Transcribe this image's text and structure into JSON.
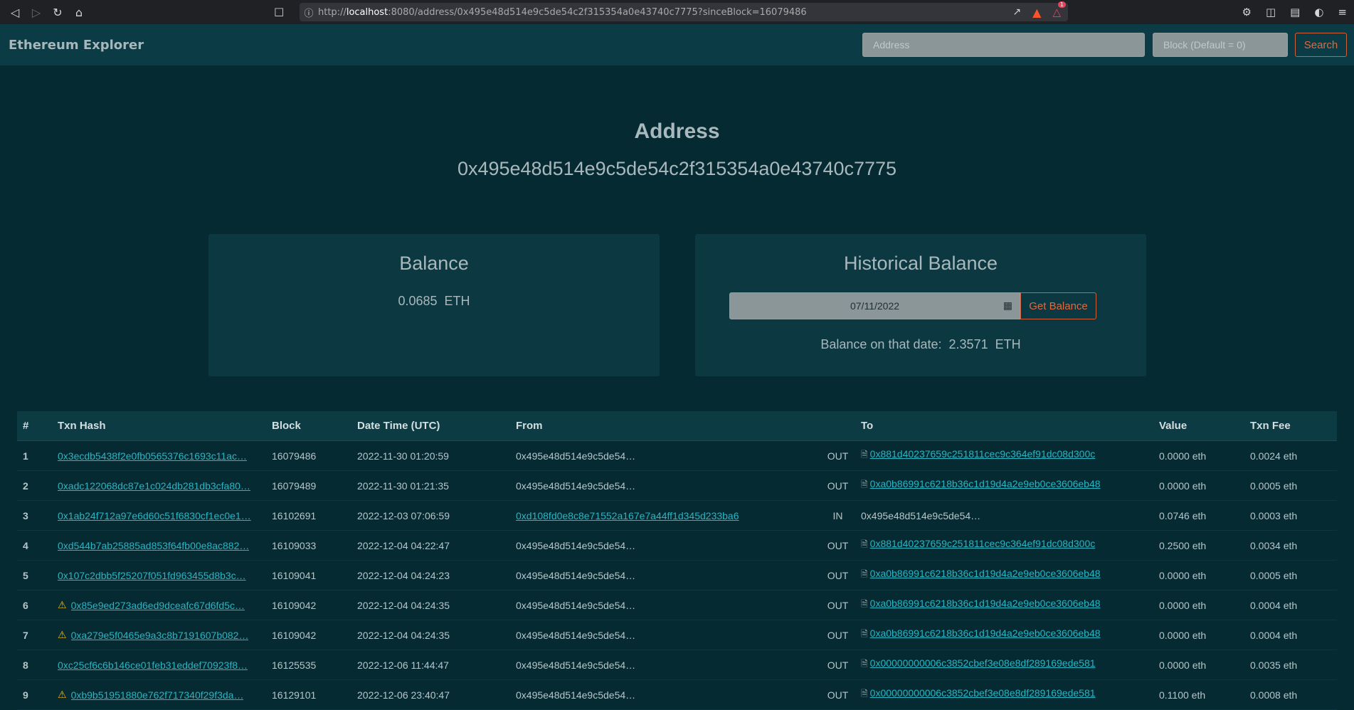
{
  "browser": {
    "url_prefix": "http://",
    "url_host": "localhost",
    "url_rest": ":8080/address/0x495e48d514e9c5de54c2f315354a0e43740c7775?sinceBlock=16079486",
    "rewards_badge": "1"
  },
  "navbar": {
    "brand": "Ethereum Explorer",
    "address_placeholder": "Address",
    "block_placeholder": "Block (Default = 0)",
    "search_label": "Search"
  },
  "header": {
    "title": "Address",
    "address": "0x495e48d514e9c5de54c2f315354a0e43740c7775"
  },
  "balance": {
    "title": "Balance",
    "value": "0.0685",
    "unit": "ETH"
  },
  "historical": {
    "title": "Historical Balance",
    "date": "07/11/2022",
    "button": "Get Balance",
    "result_label": "Balance on that date:",
    "result_value": "2.3571",
    "result_unit": "ETH"
  },
  "table": {
    "headers": [
      "#",
      "Txn Hash",
      "Block",
      "Date Time (UTC)",
      "From",
      "",
      "To",
      "Value",
      "Txn Fee"
    ],
    "rows": [
      {
        "n": "1",
        "hash": "0x3ecdb5438f2e0fb0565376c1693c11ac…",
        "warn": false,
        "block": "16079486",
        "date": "2022-11-30 01:20:59",
        "from": "0x495e48d514e9c5de54…",
        "from_link": false,
        "dir": "OUT",
        "to": "0x881d40237659c251811cec9c364ef91dc08d300c",
        "to_link": true,
        "value": "0.0000 eth",
        "fee": "0.0024 eth"
      },
      {
        "n": "2",
        "hash": "0xadc122068dc87e1c024db281db3cfa80…",
        "warn": false,
        "block": "16079489",
        "date": "2022-11-30 01:21:35",
        "from": "0x495e48d514e9c5de54…",
        "from_link": false,
        "dir": "OUT",
        "to": "0xa0b86991c6218b36c1d19d4a2e9eb0ce3606eb48",
        "to_link": true,
        "value": "0.0000 eth",
        "fee": "0.0005 eth"
      },
      {
        "n": "3",
        "hash": "0x1ab24f712a97e6d60c51f6830cf1ec0e1…",
        "warn": false,
        "block": "16102691",
        "date": "2022-12-03 07:06:59",
        "from": "0xd108fd0e8c8e71552a167e7a44ff1d345d233ba6",
        "from_link": true,
        "dir": "IN",
        "to": "0x495e48d514e9c5de54…",
        "to_link": false,
        "value": "0.0746 eth",
        "fee": "0.0003 eth"
      },
      {
        "n": "4",
        "hash": "0xd544b7ab25885ad853f64fb00e8ac882…",
        "warn": false,
        "block": "16109033",
        "date": "2022-12-04 04:22:47",
        "from": "0x495e48d514e9c5de54…",
        "from_link": false,
        "dir": "OUT",
        "to": "0x881d40237659c251811cec9c364ef91dc08d300c",
        "to_link": true,
        "value": "0.2500 eth",
        "fee": "0.0034 eth"
      },
      {
        "n": "5",
        "hash": "0x107c2dbb5f25207f051fd963455d8b3c…",
        "warn": false,
        "block": "16109041",
        "date": "2022-12-04 04:24:23",
        "from": "0x495e48d514e9c5de54…",
        "from_link": false,
        "dir": "OUT",
        "to": "0xa0b86991c6218b36c1d19d4a2e9eb0ce3606eb48",
        "to_link": true,
        "value": "0.0000 eth",
        "fee": "0.0005 eth"
      },
      {
        "n": "6",
        "hash": "0x85e9ed273ad6ed9dceafc67d6fd5c…",
        "warn": true,
        "block": "16109042",
        "date": "2022-12-04 04:24:35",
        "from": "0x495e48d514e9c5de54…",
        "from_link": false,
        "dir": "OUT",
        "to": "0xa0b86991c6218b36c1d19d4a2e9eb0ce3606eb48",
        "to_link": true,
        "value": "0.0000 eth",
        "fee": "0.0004 eth"
      },
      {
        "n": "7",
        "hash": "0xa279e5f0465e9a3c8b7191607b082…",
        "warn": true,
        "block": "16109042",
        "date": "2022-12-04 04:24:35",
        "from": "0x495e48d514e9c5de54…",
        "from_link": false,
        "dir": "OUT",
        "to": "0xa0b86991c6218b36c1d19d4a2e9eb0ce3606eb48",
        "to_link": true,
        "value": "0.0000 eth",
        "fee": "0.0004 eth"
      },
      {
        "n": "8",
        "hash": "0xc25cf6c6b146ce01feb31eddef70923f8…",
        "warn": false,
        "block": "16125535",
        "date": "2022-12-06 11:44:47",
        "from": "0x495e48d514e9c5de54…",
        "from_link": false,
        "dir": "OUT",
        "to": "0x00000000006c3852cbef3e08e8df289169ede581",
        "to_link": true,
        "value": "0.0000 eth",
        "fee": "0.0035 eth"
      },
      {
        "n": "9",
        "hash": "0xb9b51951880e762f717340f29f3da…",
        "warn": true,
        "block": "16129101",
        "date": "2022-12-06 23:40:47",
        "from": "0x495e48d514e9c5de54…",
        "from_link": false,
        "dir": "OUT",
        "to": "0x00000000006c3852cbef3e08e8df289169ede581",
        "to_link": true,
        "value": "0.1100 eth",
        "fee": "0.0008 eth"
      }
    ]
  },
  "colors": {
    "background": "#052a32",
    "navbar": "#0b3b44",
    "card": "#0c3841",
    "accent_orange": "#e0693f",
    "link": "#27b6c4",
    "warning": "#f5b301"
  },
  "icons": {
    "back": "arrow-left-icon",
    "forward": "arrow-right-icon",
    "reload": "reload-icon",
    "home": "home-icon",
    "bookmark": "bookmark-icon",
    "site_info": "info-icon",
    "share": "share-icon",
    "brave": "brave-lion-icon",
    "rewards": "rewards-triangle-icon",
    "extensions": "puzzle-icon",
    "sidebar": "sidebar-icon",
    "wallet": "wallet-icon",
    "profile": "profile-icon",
    "menu": "menu-icon",
    "calendar": "calendar-icon",
    "contract": "document-icon",
    "warning": "warning-triangle-icon"
  }
}
